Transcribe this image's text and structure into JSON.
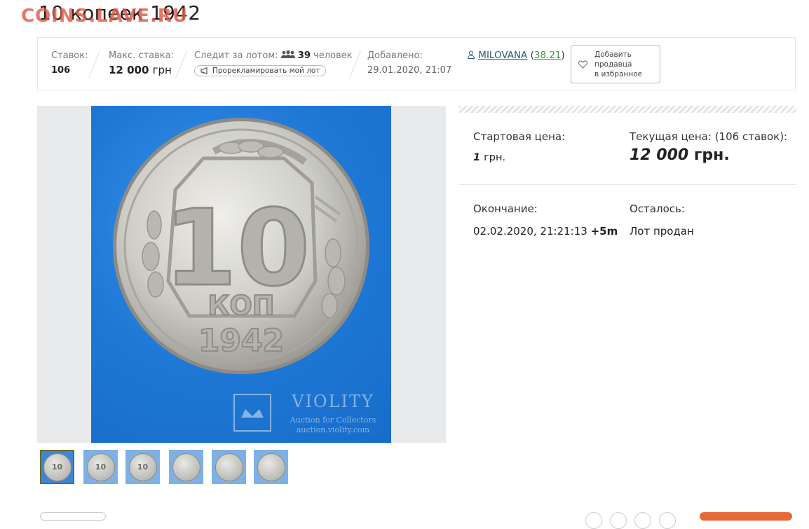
{
  "page": {
    "title": "10 копеек 1942",
    "watermark": "COINS.LAVE.RU"
  },
  "lot_info": {
    "bids_label": "Ставок:",
    "bids_value": "106",
    "max_bid_label": "Макс. ставка:",
    "max_bid_value": "12 000",
    "max_bid_currency": "грн",
    "watchers_label": "Следит за лотом:",
    "watchers_count": "39",
    "watchers_unit": "человек",
    "promo_button": "Прорекламировать мой лот",
    "added_label": "Добавлено:",
    "added_value": "29.01.2020, 21:07",
    "seller_name": "MILOVANA",
    "seller_rating": "38.21",
    "fav_button_line1": "Добавить",
    "fav_button_line2": "продавца",
    "fav_button_line3": "в избранное"
  },
  "photo": {
    "coin_denomination": "10",
    "coin_unit": "КОП",
    "coin_year": "1942",
    "watermark_brand": "VIOLITY",
    "watermark_sub1": "Auction for Collectors",
    "watermark_sub2": "auction.violity.com"
  },
  "thumbnails": [
    {
      "label": "10",
      "active": true
    },
    {
      "label": "10",
      "active": false
    },
    {
      "label": "10",
      "active": false
    },
    {
      "label": "",
      "active": false
    },
    {
      "label": "",
      "active": false
    },
    {
      "label": "",
      "active": false
    }
  ],
  "prices": {
    "start_label": "Стартовая цена:",
    "start_value": "1",
    "start_currency": "грн.",
    "current_label": "Текущая цена: (106 ставок):",
    "current_value": "12 000",
    "current_currency": "грн.",
    "end_label": "Окончание:",
    "end_value": "02.02.2020, 21:21:13",
    "end_extra": "+5m",
    "remaining_label": "Осталось:",
    "remaining_value": "Лот продан"
  },
  "colors": {
    "accent_orange": "#e7693a",
    "seller_link": "#2a5b7f",
    "rating_green": "#3c9a3c",
    "photo_bg": "#1f78d6"
  }
}
